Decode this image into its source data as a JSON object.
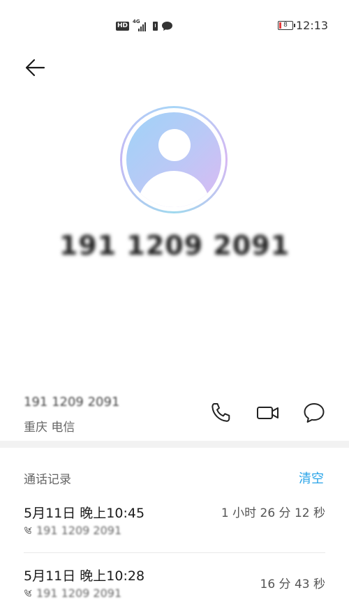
{
  "status_bar": {
    "hd": "HD",
    "network": "4G",
    "battery_level": "8",
    "time": "12:13"
  },
  "contact": {
    "number": "191 1209 2091",
    "number_small": "191 1209 2091",
    "carrier": "重庆 电信"
  },
  "icons": {
    "back": "back-arrow-icon",
    "call": "phone-icon",
    "video": "video-camera-icon",
    "message": "message-bubble-icon",
    "call_type": "incoming-call-icon"
  },
  "history": {
    "title": "通话记录",
    "clear_label": "清空",
    "calls": [
      {
        "date": "5月11日 晚上10:45",
        "number": "191 1209 2091",
        "duration": "1 小时 26 分 12 秒"
      },
      {
        "date": "5月11日 晚上10:28",
        "number": "191 1209 2091",
        "duration": "16 分 43 秒"
      }
    ]
  },
  "colors": {
    "accent": "#2aa4e8",
    "avatar_gradient_start": "#9fd3f8",
    "avatar_gradient_end": "#dcb9f3"
  }
}
